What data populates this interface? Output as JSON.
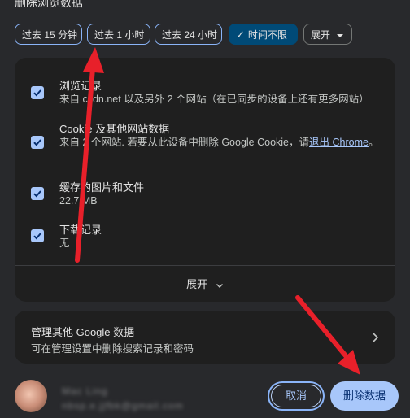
{
  "dialog": {
    "title": "删除浏览数据"
  },
  "time_range": {
    "chips": [
      {
        "label": "过去 15 分钟",
        "selected": false
      },
      {
        "label": "过去 1 小时",
        "selected": false
      },
      {
        "label": "过去 24 小时",
        "selected": false
      },
      {
        "label": "时间不限",
        "selected": true
      }
    ],
    "more_label": "展开"
  },
  "items": [
    {
      "title": "浏览记录",
      "desc": "来自 csdn.net 以及另外 2 个网站（在已同步的设备上还有更多网站）",
      "checked": true
    },
    {
      "title": "Cookie 及其他网站数据",
      "desc_pre": "来自 2 个网站. 若要从此设备中删除 Google Cookie，请",
      "desc_link": "退出 Chrome",
      "desc_post": "。",
      "checked": true
    },
    {
      "title": "缓存的图片和文件",
      "desc": "22.7 MB",
      "checked": true
    },
    {
      "title": "下载记录",
      "desc": "无",
      "checked": true
    }
  ],
  "expand_label": "展开",
  "google_data": {
    "title": "管理其他 Google 数据",
    "subtitle": "可在管理设置中删除搜索记录和密码"
  },
  "account": {
    "name": "Mac Ling",
    "email": "nbsp.e.jjfbk@gmail.com"
  },
  "buttons": {
    "cancel": "取消",
    "delete": "删除数据"
  },
  "colors": {
    "accent": "#a8c7fa",
    "selected_chip": "#004a77",
    "arrow": "#e8202a"
  }
}
